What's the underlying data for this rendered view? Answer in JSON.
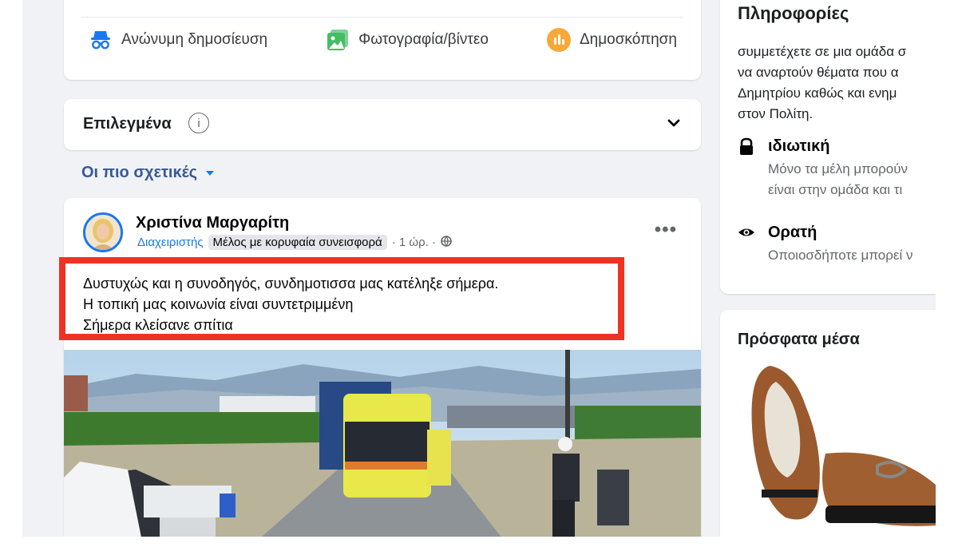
{
  "composer": {
    "anonymous_label": "Ανώνυμη δημοσίευση",
    "photo_label": "Φωτογραφία/βίντεο",
    "poll_label": "Δημοσκόπηση"
  },
  "featured": {
    "title": "Επιλεγμένα",
    "info_glyph": "i"
  },
  "sort": {
    "label": "Οι πιο σχετικές"
  },
  "post": {
    "author": "Χριστίνα Μαργαρίτη",
    "role": "Διαχειριστής",
    "badge": "Μέλος με κορυφαία συνεισφορά",
    "time": "· 1 ώρ. ·",
    "more": "•••",
    "text_lines": [
      "Δυστυχώς και η συνοδηγός, συνδημοτισσα μας κατέληξε σήμερα.",
      "Η τοπική μας κοινωνία είναι συντετριμμένη",
      "Σήμερα κλείσανε σπίτια"
    ]
  },
  "about": {
    "header": "Πληροφορίες",
    "description_lines": [
      "συμμετέχετε σε μια ομάδα σ",
      "να αναρτούν θέματα που α",
      "Δημητρίου καθώς και ενημ",
      "στον Πολίτη."
    ],
    "privacy_title": "ιδιωτική",
    "privacy_lines": [
      "Μόνο τα μέλη μπορούν",
      "είναι στην ομάδα και τι"
    ],
    "visibility_title": "Ορατή",
    "visibility_line": "Οποιοσδήποτε μπορεί ν"
  },
  "media": {
    "header": "Πρόσφατα μέσα"
  },
  "colors": {
    "accent": "#1877f2",
    "highlight_box": "#ee3325",
    "background": "#f0f2f5"
  }
}
